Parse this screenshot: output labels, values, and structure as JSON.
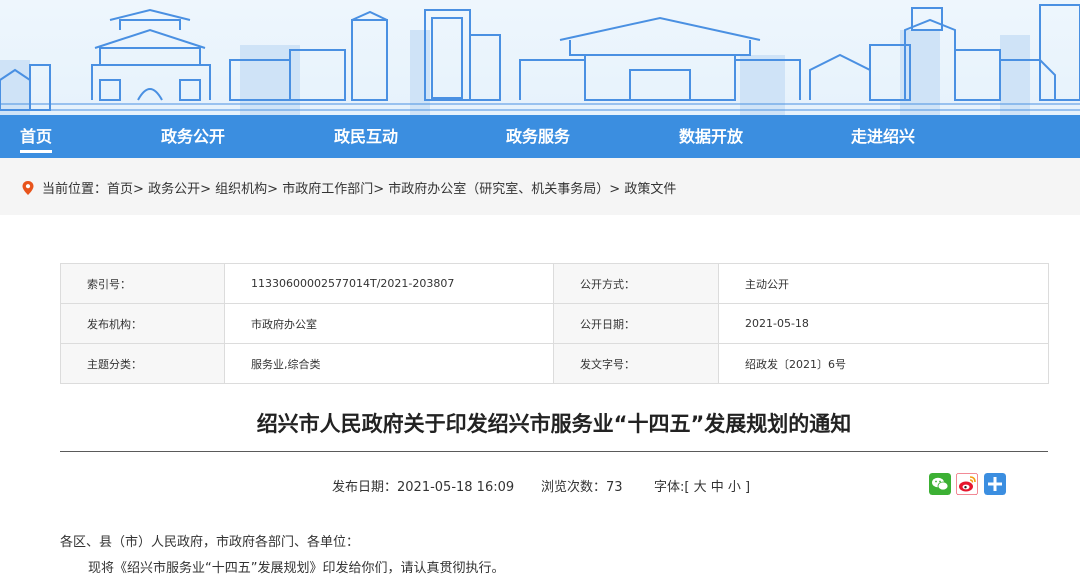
{
  "nav": {
    "items": [
      {
        "label": "首页"
      },
      {
        "label": "政务公开"
      },
      {
        "label": "政民互动"
      },
      {
        "label": "政务服务"
      },
      {
        "label": "数据开放"
      },
      {
        "label": "走进绍兴"
      }
    ]
  },
  "breadcrumb": {
    "prefix": "当前位置：",
    "items": [
      "首页",
      "政务公开",
      "组织机构",
      "市政府工作部门",
      "市政府办公室（研究室、机关事务局）",
      "政策文件"
    ],
    "separator": ">"
  },
  "meta": {
    "rows": [
      [
        {
          "k": "索引号：",
          "v": "11330600002577014T/2021-203807"
        },
        {
          "k": "公开方式：",
          "v": "主动公开"
        }
      ],
      [
        {
          "k": "发布机构：",
          "v": "市政府办公室"
        },
        {
          "k": "公开日期：",
          "v": "2021-05-18"
        }
      ],
      [
        {
          "k": "主题分类：",
          "v": "服务业,综合类"
        },
        {
          "k": "发文字号：",
          "v": "绍政发〔2021〕6号"
        }
      ]
    ]
  },
  "article": {
    "title": "绍兴市人民政府关于印发绍兴市服务业“十四五”发展规划的通知",
    "publish": "发布日期：2021-05-18 16:09",
    "views": "浏览次数：73",
    "font_label": "字体:[ 大 中 小 ]",
    "addressee": "各区、县（市）人民政府，市政府各部门、各单位：",
    "body": "现将《绍兴市服务业“十四五”发展规划》印发给你们，请认真贯彻执行。"
  },
  "share": {
    "icons": [
      "wechat-icon",
      "weibo-icon",
      "more-share-icon"
    ]
  },
  "colors": {
    "nav_bg": "#3b8ee0",
    "banner_bg": "#eef6fd",
    "building": "#4a90e2",
    "crumb_bg": "#f5f5f5",
    "wechat": "#3cb034",
    "weibo": "#e6162d",
    "plus": "#3b8ee0"
  }
}
